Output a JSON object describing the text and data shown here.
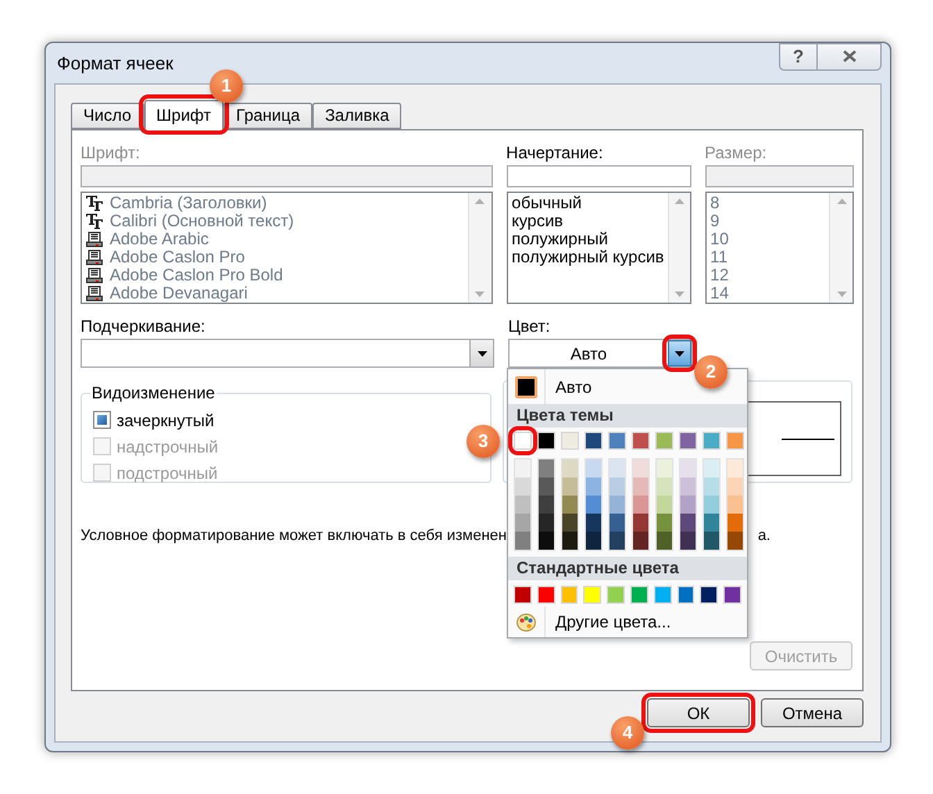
{
  "window": {
    "title": "Формат ячеек",
    "help": "?"
  },
  "tabs": [
    {
      "label": "Число",
      "selected": false
    },
    {
      "label": "Шрифт",
      "selected": true,
      "callout": {
        "number": "1",
        "kind": "above"
      }
    },
    {
      "label": "Граница",
      "selected": false
    },
    {
      "label": "Заливка",
      "selected": false
    }
  ],
  "font": {
    "label": "Шрифт:",
    "disabled": true,
    "items": [
      {
        "name": "Cambria (Заголовки)",
        "kind": "truetype"
      },
      {
        "name": "Calibri (Основной текст)",
        "kind": "truetype"
      },
      {
        "name": "Adobe Arabic",
        "kind": "printer"
      },
      {
        "name": "Adobe Caslon Pro",
        "kind": "printer"
      },
      {
        "name": "Adobe Caslon Pro Bold",
        "kind": "printer"
      },
      {
        "name": "Adobe Devanagari",
        "kind": "printer"
      }
    ]
  },
  "style": {
    "label": "Начертание:",
    "disabled": false,
    "items": [
      "обычный",
      "курсив",
      "полужирный",
      "полужирный курсив"
    ]
  },
  "size": {
    "label": "Размер:",
    "disabled": true,
    "items": [
      "8",
      "9",
      "10",
      "11",
      "12",
      "14"
    ]
  },
  "underline": {
    "label": "Подчеркивание:"
  },
  "color": {
    "label": "Цвет:",
    "value": "Авто",
    "callout": {
      "number": "2",
      "kind": "right"
    }
  },
  "effects": {
    "title": "Видоизменение",
    "items": [
      {
        "label": "зачеркнутый",
        "checked": true,
        "disabled": false
      },
      {
        "label": "надстрочный",
        "checked": false,
        "disabled": true
      },
      {
        "label": "подстрочный",
        "checked": false,
        "disabled": true
      }
    ]
  },
  "message": {
    "start": "Условное форматирование может включать в себя изменен",
    "end": "а."
  },
  "clear_button": {
    "label": "Очистить",
    "disabled": true
  },
  "palette": {
    "auto": {
      "label": "Авто",
      "color": "#000000"
    },
    "theme_header": "Цвета темы",
    "theme": [
      {
        "color": "#ffffff",
        "callout": {
          "number": "3",
          "kind": "left"
        },
        "shades": [
          {
            "color": "#f2f2f2"
          },
          {
            "color": "#d9d9d9"
          },
          {
            "color": "#bfbfbf"
          },
          {
            "color": "#a6a6a6"
          },
          {
            "color": "#808080"
          }
        ]
      },
      {
        "color": "#000000",
        "shades": [
          {
            "color": "#7f7f7f"
          },
          {
            "color": "#595959"
          },
          {
            "color": "#3f3f3f"
          },
          {
            "color": "#262626"
          },
          {
            "color": "#0d0d0d"
          }
        ]
      },
      {
        "color": "#eeece1",
        "shades": [
          {
            "color": "#ddd9c3"
          },
          {
            "color": "#c4bd97"
          },
          {
            "color": "#938953"
          },
          {
            "color": "#494429"
          },
          {
            "color": "#1d1b10"
          }
        ]
      },
      {
        "color": "#1f497d",
        "shades": [
          {
            "color": "#c6d9f0"
          },
          {
            "color": "#8db3e2"
          },
          {
            "color": "#548dd4"
          },
          {
            "color": "#17365d"
          },
          {
            "color": "#0f243e"
          }
        ]
      },
      {
        "color": "#4f81bd",
        "shades": [
          {
            "color": "#dbe5f1"
          },
          {
            "color": "#b8cce4"
          },
          {
            "color": "#95b3d7"
          },
          {
            "color": "#366092"
          },
          {
            "color": "#244061"
          }
        ]
      },
      {
        "color": "#c0504d",
        "shades": [
          {
            "color": "#f2dcdb"
          },
          {
            "color": "#e5b9b7"
          },
          {
            "color": "#d99694"
          },
          {
            "color": "#953734"
          },
          {
            "color": "#632423"
          }
        ]
      },
      {
        "color": "#9bbb59",
        "shades": [
          {
            "color": "#ebf1dd"
          },
          {
            "color": "#d7e3bc"
          },
          {
            "color": "#c3d69b"
          },
          {
            "color": "#76923c"
          },
          {
            "color": "#4f6128"
          }
        ]
      },
      {
        "color": "#8064a2",
        "shades": [
          {
            "color": "#e5e0ec"
          },
          {
            "color": "#ccc1d9"
          },
          {
            "color": "#b2a2c7"
          },
          {
            "color": "#5f497a"
          },
          {
            "color": "#3f3151"
          }
        ]
      },
      {
        "color": "#4bacc6",
        "shades": [
          {
            "color": "#dbeef3"
          },
          {
            "color": "#b7dde8"
          },
          {
            "color": "#92cddc"
          },
          {
            "color": "#31859b"
          },
          {
            "color": "#205867"
          }
        ]
      },
      {
        "color": "#f79646",
        "shades": [
          {
            "color": "#fdeada"
          },
          {
            "color": "#fbd5b5"
          },
          {
            "color": "#fac08f"
          },
          {
            "color": "#e36c09"
          },
          {
            "color": "#974806"
          }
        ]
      }
    ],
    "standard_header": "Стандартные цвета",
    "standard": [
      {
        "color": "#c00000"
      },
      {
        "color": "#ff0000"
      },
      {
        "color": "#ffc000"
      },
      {
        "color": "#ffff00"
      },
      {
        "color": "#92d050"
      },
      {
        "color": "#00b050"
      },
      {
        "color": "#00b0f0"
      },
      {
        "color": "#0070c0"
      },
      {
        "color": "#002060"
      },
      {
        "color": "#7030a0"
      }
    ],
    "more": "Другие цвета..."
  },
  "buttons": [
    {
      "label": "ОК",
      "callout": {
        "number": "4",
        "kind": "below"
      }
    },
    {
      "label": "Отмена"
    }
  ]
}
